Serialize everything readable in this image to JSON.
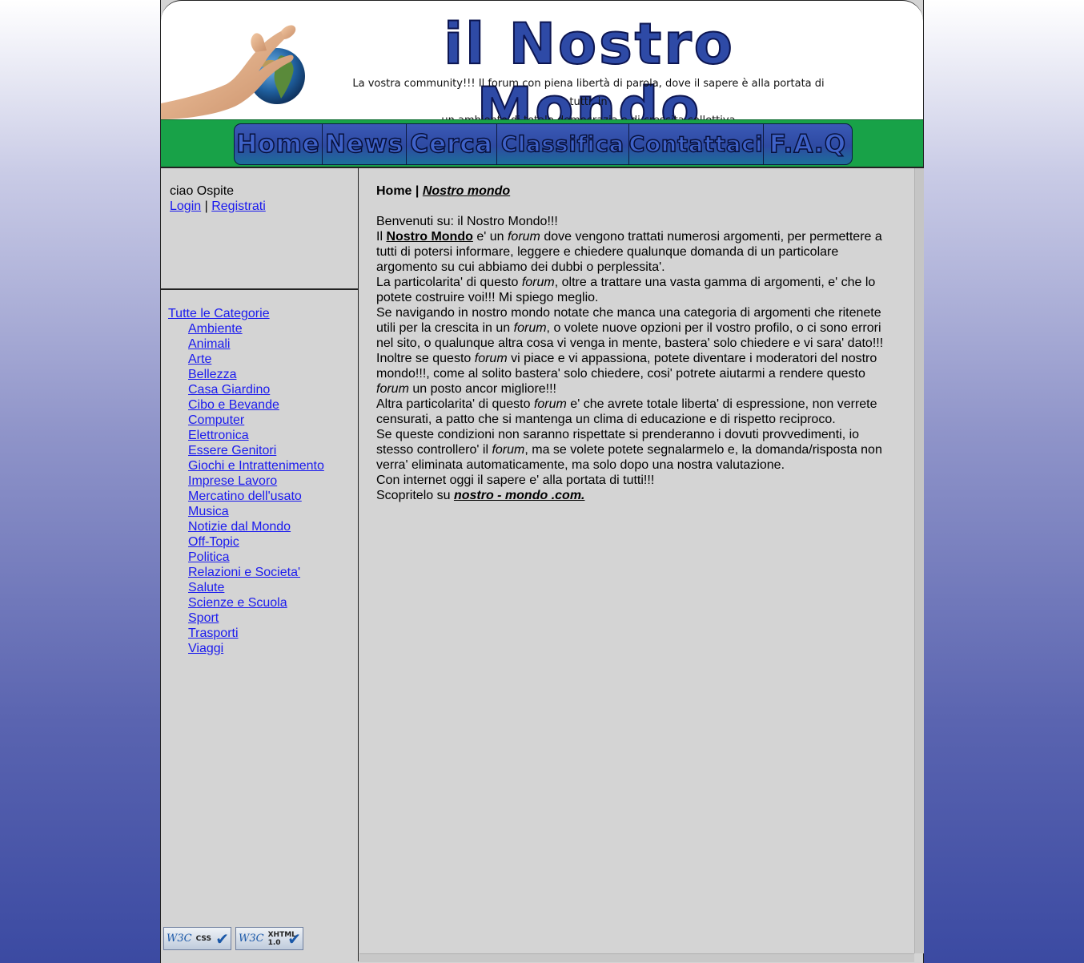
{
  "header": {
    "logo_text": "il Nostro Mondo",
    "tagline_line1": "La vostra community!!! Il forum con piena libertà di parola, dove il sapere è alla portata di tutti, in",
    "tagline_line2": "un ambiente di totale democrazia e di crescita collettiva",
    "image_icon": "hand-holding-globe"
  },
  "nav": {
    "items": [
      "Home",
      "News",
      "Cerca",
      "Classifica",
      "Contattaci",
      "F.A.Q"
    ]
  },
  "sidebar": {
    "greeting": "ciao Ospite",
    "login_label": "Login",
    "separator": "|",
    "register_label": "Registrati",
    "all_categories_label": "Tutte le Categorie",
    "categories": [
      "Ambiente",
      "Animali",
      "Arte",
      "Bellezza",
      "Casa Giardino",
      "Cibo e Bevande",
      "Computer",
      "Elettronica",
      "Essere Genitori",
      "Giochi e Intrattenimento",
      "Imprese Lavoro",
      "Mercatino dell'usato",
      "Musica",
      "Notizie dal Mondo",
      "Off-Topic",
      "Politica",
      "Relazioni e Societa'",
      "Salute",
      "Scienze e Scuola",
      "Sport",
      "Trasporti",
      "Viaggi"
    ],
    "badges": [
      {
        "logo": "W3C",
        "label": "CSS",
        "sub": ""
      },
      {
        "logo": "W3C",
        "label": "XHTML",
        "sub": "1.0"
      }
    ]
  },
  "content": {
    "breadcrumb_home": "Home",
    "breadcrumb_sep": "|",
    "breadcrumb_current": "Nostro mondo",
    "welcome": "Benvenuti su: il Nostro Mondo!!!",
    "p1_a": "Il ",
    "p1_link": "Nostro Mondo",
    "p1_b": " e' un ",
    "p1_em": "forum",
    "p1_c": " dove vengono trattati numerosi argomenti, per permettere a tutti di potersi informare, leggere e chiedere qualunque domanda di un particolare argomento su cui abbiamo dei dubbi o perplessita'.",
    "p2_a": "La particolarita' di questo ",
    "p2_em": "forum",
    "p2_b": ", oltre a trattare una vasta gamma di argomenti, e' che lo potete costruire voi!!! Mi spiego meglio.",
    "p3_a": "Se navigando in nostro mondo notate che manca una categoria di argomenti che ritenete utili per la crescita in un ",
    "p3_em": "forum",
    "p3_b": ", o volete nuove opzioni per il vostro profilo, o ci sono errori nel sito, o qualunque altra cosa vi venga in mente, bastera' solo chiedere e vi sara' dato!!!",
    "p4_a": "Inoltre se questo ",
    "p4_em": "forum",
    "p4_b": " vi piace e vi appassiona, potete diventare i moderatori del nostro mondo!!!, come al solito bastera' solo chiedere, cosi' potrete aiutarmi a rendere questo ",
    "p4_em2": "forum",
    "p4_c": " un posto ancor migliore!!!",
    "p5_a": "Altra particolarita' di questo ",
    "p5_em": "forum",
    "p5_b": " e' che avrete totale liberta' di espressione, non verrete censurati, a patto che si mantenga un clima di educazione e di rispetto reciproco.",
    "p6_a": "Se queste condizioni non saranno rispettate si prenderanno i dovuti provvedimenti, io stesso controllero' il ",
    "p6_em": "forum",
    "p6_b": ", ma se volete potete segnalarmelo e, la domanda/risposta non verra' eliminata automaticamente, ma solo dopo una nostra valutazione.",
    "p7": "Con internet oggi il sapere e' alla portata di tutti!!!",
    "p8_a": "Scopritelo su ",
    "p8_link": "nostro - mondo .com."
  }
}
